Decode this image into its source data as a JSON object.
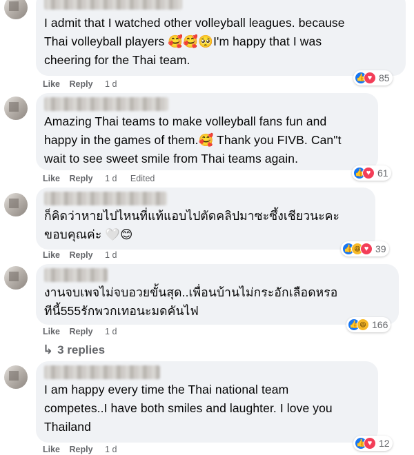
{
  "comments": [
    {
      "text": "I admit that I watched other volleyball leagues. because\nThai volleyball players 🥰🥰🥺I'm happy that I was\ncheering for the Thai team.",
      "like": "Like",
      "reply": "Reply",
      "time": "1 d",
      "edited": "",
      "react_icons": [
        "like-icon",
        "love-icon"
      ],
      "react_count": "85"
    },
    {
      "text": "Amazing Thai teams to make volleyball fans fun and\nhappy in the games of them.🥰 Thank you FIVB. Can\"t\nwait to see sweet smile from Thai teams again.",
      "like": "Like",
      "reply": "Reply",
      "time": "1 d",
      "edited": "Edited",
      "react_icons": [
        "like-icon",
        "love-icon"
      ],
      "react_count": "61"
    },
    {
      "text": "ก็คิดว่าหายไปไหนที่แท้แอบไปตัดคลิปมาซะซึ้งเชียวนะคะ\nขอบคุณค่ะ 🤍😊",
      "like": "Like",
      "reply": "Reply",
      "time": "1 d",
      "edited": "",
      "react_icons": [
        "like-icon",
        "haha-icon",
        "love-icon"
      ],
      "react_count": "39"
    },
    {
      "text": "งานจบเพจไม่จบอวยขั้นสุด..เพื่อนบ้านไม่กระอักเลือดหรอ\nทีนี้555รักพวกเทอนะมดคันไฟ",
      "like": "Like",
      "reply": "Reply",
      "time": "1 d",
      "edited": "",
      "react_icons": [
        "like-icon",
        "haha-icon"
      ],
      "react_count": "166"
    },
    {
      "text": "I am happy every time the Thai national team\ncompetes..I have both smiles and laughter. I love you\nThailand",
      "like": "Like",
      "reply": "Reply",
      "time": "1 d",
      "edited": "",
      "react_icons": [
        "like-icon",
        "love-icon"
      ],
      "react_count": "12"
    }
  ],
  "replies_label": "3 replies",
  "colors": {
    "bubble": "#f0f2f5",
    "like": "#1877f2",
    "love": "#f33e58",
    "haha": "#f7b928",
    "meta": "#65676b"
  }
}
